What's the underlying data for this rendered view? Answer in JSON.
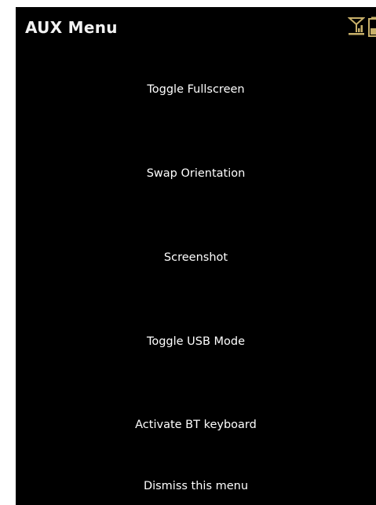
{
  "header": {
    "title": "AUX Menu",
    "icons": [
      "signal-icon",
      "battery-icon"
    ]
  },
  "menu": {
    "items": [
      {
        "label": "Toggle Fullscreen"
      },
      {
        "label": "Swap Orientation"
      },
      {
        "label": "Screenshot"
      },
      {
        "label": "Toggle USB Mode"
      },
      {
        "label": "Activate BT keyboard"
      },
      {
        "label": "Dismiss this menu"
      }
    ]
  },
  "colors": {
    "background": "#000000",
    "text": "#ffffff",
    "icon": "#c8b06a"
  }
}
